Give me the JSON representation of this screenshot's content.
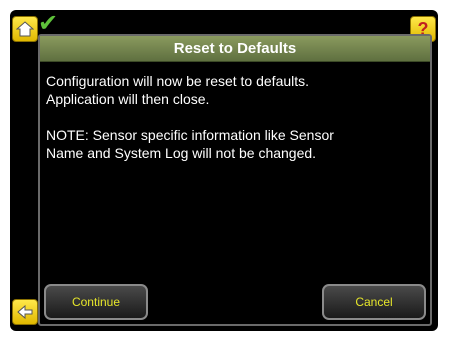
{
  "dialog": {
    "title": "Reset to Defaults",
    "message_line1": "Configuration will now be reset to defaults.",
    "message_line2": "Application will then close.",
    "note_line1": "NOTE: Sensor specific information like Sensor",
    "note_line2": "Name and System Log will not be changed."
  },
  "buttons": {
    "continue_label": "Continue",
    "cancel_label": "Cancel"
  },
  "icons": {
    "home": "home-icon",
    "status": "check-icon",
    "help": "help-icon",
    "back": "back-arrow-icon"
  },
  "colors": {
    "title_bar": "#6f8050",
    "button_text": "#e6e62a",
    "icon_yellow": "#f0d020"
  }
}
